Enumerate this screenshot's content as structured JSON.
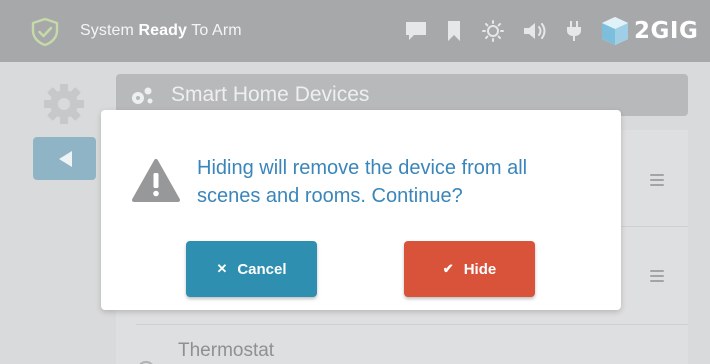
{
  "status_bar": {
    "status_prefix": "System ",
    "status_bold": "Ready",
    "status_suffix": " To Arm",
    "brand": "2GIG",
    "icons": [
      "shield-check-icon",
      "message-icon",
      "bookmark-icon",
      "brightness-icon",
      "volume-icon",
      "power-plug-icon",
      "2gig-logo-icon"
    ]
  },
  "page": {
    "section_title": "Smart Home Devices",
    "device_visible": "Thermostat"
  },
  "modal": {
    "message": "Hiding will remove the device from all scenes and rooms. Continue?",
    "cancel_icon": "✕",
    "cancel_label": "Cancel",
    "hide_icon": "✔",
    "hide_label": "Hide"
  },
  "colors": {
    "status_bar_bg": "#a7a8aa",
    "message_text": "#3a86ba",
    "cancel_button": "#2e8fb0",
    "hide_button": "#d9533a",
    "back_button": "#8fb4c6"
  }
}
